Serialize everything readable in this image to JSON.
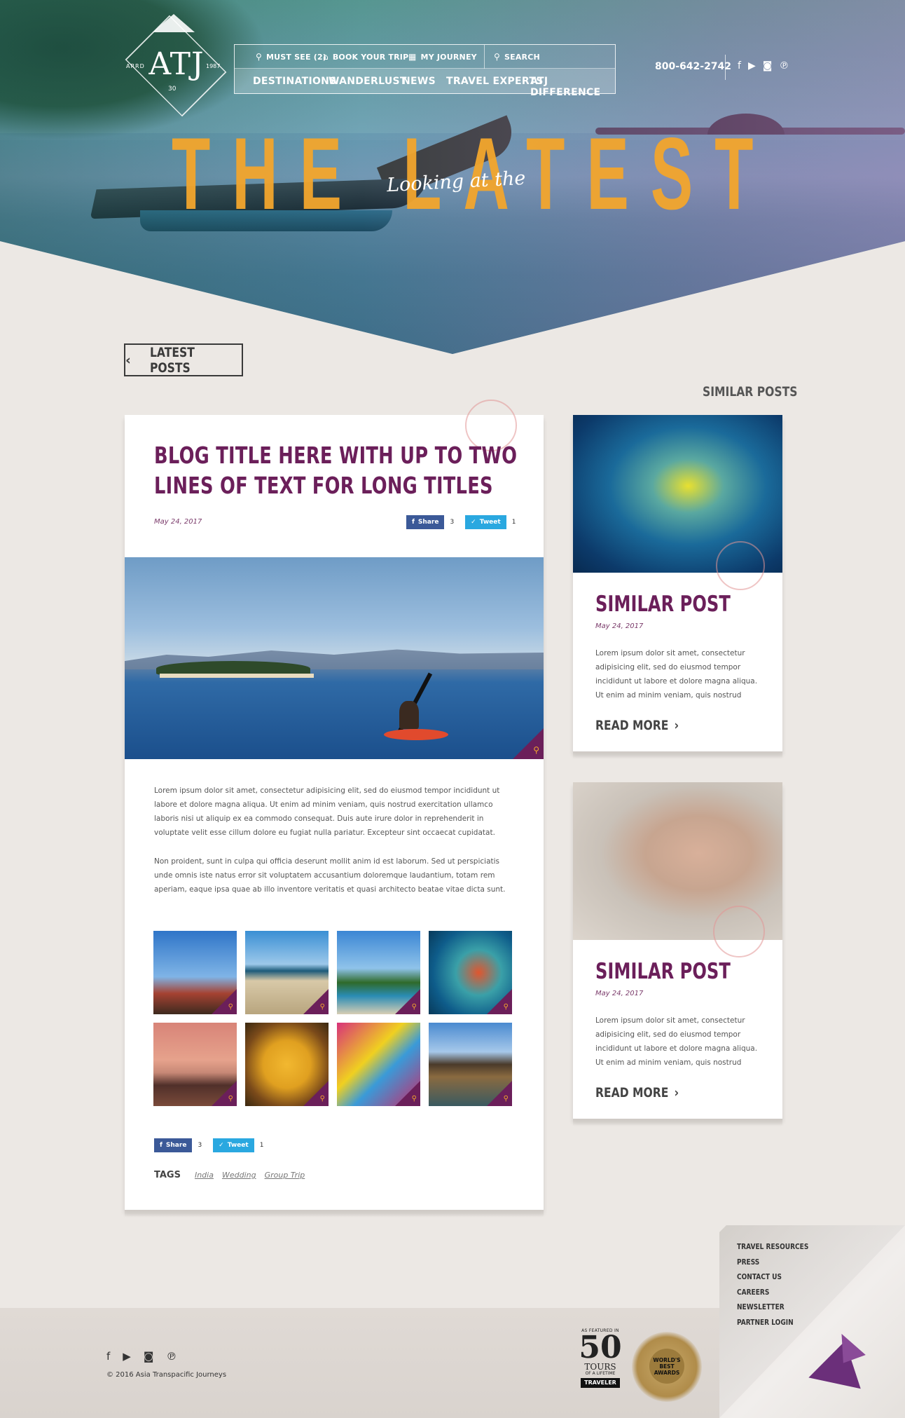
{
  "header": {
    "logo": {
      "mark": "ATJ",
      "left": "ARRD",
      "right": "1987",
      "bottom": "30"
    },
    "utility": [
      {
        "icon": "pin-icon",
        "label": "MUST SEE (2)"
      },
      {
        "icon": "tag-icon",
        "label": "BOOK YOUR TRIP"
      },
      {
        "icon": "map-icon",
        "label": "MY JOURNEY"
      },
      {
        "icon": "search-icon",
        "label": "SEARCH"
      }
    ],
    "nav": [
      "DESTINATIONS",
      "WANDERLUST",
      "NEWS",
      "TRAVEL EXPERTS",
      "ATJ DIFFERENCE"
    ],
    "phone": "800-642-2742",
    "social": [
      "facebook-icon",
      "youtube-icon",
      "instagram-icon",
      "pinterest-icon"
    ]
  },
  "hero": {
    "script": "Looking at the",
    "big": "THE LATEST"
  },
  "back_button": "LATEST POSTS",
  "similar_heading": "SIMILAR POSTS",
  "post": {
    "title": "BLOG TITLE HERE WITH UP TO TWO LINES OF TEXT FOR LONG TITLES",
    "date": "May 24, 2017",
    "share": {
      "fb_label": "Share",
      "fb_count": "3",
      "tw_label": "Tweet",
      "tw_count": "1"
    },
    "paragraphs": [
      "Lorem ipsum dolor sit amet, consectetur adipisicing elit, sed do eiusmod tempor incididunt ut labore et dolore magna aliqua. Ut enim ad minim veniam, quis nostrud exercitation ullamco laboris nisi ut aliquip ex ea commodo consequat. Duis aute irure dolor in reprehenderit in voluptate velit esse cillum dolore eu fugiat nulla pariatur. Excepteur sint occaecat cupidatat.",
      "Non proident, sunt in culpa qui officia deserunt mollit anim id est laborum. Sed ut perspiciatis unde omnis iste natus error sit voluptatem accusantium doloremque laudantium, totam rem aperiam, eaque ipsa quae ab illo inventore veritatis et quasi architecto beatae vitae dicta sunt."
    ],
    "tags_label": "TAGS",
    "tags": [
      "India",
      "Wedding",
      "Group Trip"
    ]
  },
  "similar": [
    {
      "title": "SIMILAR POST",
      "date": "May 24, 2017",
      "excerpt": "Lorem ipsum dolor sit amet, consectetur adipisicing elit, sed do eiusmod tempor incididunt ut labore et dolore magna aliqua. Ut enim ad minim veniam, quis nostrud",
      "read_more": "READ MORE"
    },
    {
      "title": "SIMILAR POST",
      "date": "May 24, 2017",
      "excerpt": "Lorem ipsum dolor sit amet, consectetur adipisicing elit, sed do eiusmod tempor incididunt ut labore et dolore magna aliqua. Ut enim ad minim veniam, quis nostrud",
      "read_more": "READ MORE"
    }
  ],
  "footer": {
    "copyright": "© 2016 Asia Transpacific Journeys",
    "links": [
      "TRAVEL RESOURCES",
      "PRESS",
      "CONTACT US",
      "CAREERS",
      "NEWSLETTER",
      "PARTNER LOGIN"
    ],
    "tours": {
      "small": "AS FEATURED IN",
      "number": "50",
      "word": "TOURS",
      "sub": "OF A LIFETIME",
      "brand": "TRAVELER"
    },
    "award": "WORLD'S BEST AWARDS"
  },
  "colors": {
    "accent": "#6b1f5a",
    "gold": "#f3a62d",
    "facebook": "#3b5998",
    "twitter": "#2aa8e0"
  }
}
